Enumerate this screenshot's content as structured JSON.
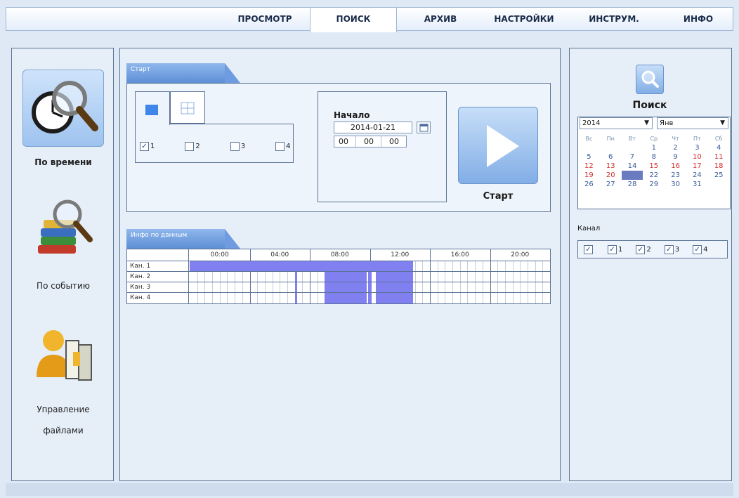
{
  "nav": {
    "tabs": [
      "ПРОСМОТР",
      "ПОИСК",
      "АРХИВ",
      "НАСТРОЙКИ",
      "ИНСТРУМ.",
      "ИНФО"
    ],
    "active_tab": "ПОИСК"
  },
  "sidebar": {
    "items": [
      {
        "label": "По времени",
        "icon": "clock-search-icon",
        "selected": true
      },
      {
        "label": "По событию",
        "icon": "books-search-icon",
        "selected": false
      },
      {
        "label_line1": "Управление",
        "label_line2": "файлами",
        "icon": "user-files-icon",
        "selected": false
      }
    ]
  },
  "start_section": {
    "tab_label": "Старт",
    "layout_buttons": [
      "single-view-icon",
      "quad-view-icon"
    ],
    "channels": [
      {
        "label": "1",
        "checked": true
      },
      {
        "label": "2",
        "checked": false
      },
      {
        "label": "3",
        "checked": false
      },
      {
        "label": "4",
        "checked": false
      }
    ],
    "start_title": "Начало",
    "date": "2014-01-21",
    "time_h": "00",
    "time_m": "00",
    "time_s": "00",
    "play_label": "Старт"
  },
  "data_info": {
    "tab_label": "Инфо по данным",
    "hours": [
      "00:00",
      "04:00",
      "08:00",
      "12:00",
      "16:00",
      "20:00"
    ],
    "rows": [
      {
        "label": "Кан. 1",
        "segments": [
          [
            0,
            14.9
          ]
        ]
      },
      {
        "label": "Кан. 2",
        "segments": [
          [
            7.0,
            7.15
          ],
          [
            9.0,
            11.8
          ],
          [
            11.9,
            12.1
          ],
          [
            12.4,
            14.9
          ]
        ]
      },
      {
        "label": "Кан. 3",
        "segments": [
          [
            7.0,
            7.15
          ],
          [
            9.0,
            11.8
          ],
          [
            11.9,
            12.1
          ],
          [
            12.4,
            14.9
          ]
        ]
      },
      {
        "label": "Кан. 4",
        "segments": [
          [
            7.0,
            7.15
          ],
          [
            9.0,
            11.8
          ],
          [
            11.9,
            12.1
          ],
          [
            12.4,
            14.9
          ]
        ]
      }
    ]
  },
  "calendar": {
    "title": "Поиск",
    "year": "2014",
    "month": "Янв",
    "weekdays": [
      "Вс",
      "Пн",
      "Вт",
      "Ср",
      "Чт",
      "Пт",
      "Сб"
    ],
    "weeks": [
      [
        "",
        "",
        "",
        "1",
        "2",
        "3",
        "4"
      ],
      [
        "5",
        "6",
        "7",
        "8",
        "9",
        "10",
        "11"
      ],
      [
        "12",
        "13",
        "14",
        "15",
        "16",
        "17",
        "18"
      ],
      [
        "19",
        "20",
        "21",
        "22",
        "23",
        "24",
        "25"
      ],
      [
        "26",
        "27",
        "28",
        "29",
        "30",
        "31",
        ""
      ]
    ],
    "red_days": [
      "10",
      "11",
      "12",
      "13",
      "15",
      "16",
      "17",
      "18",
      "19",
      "20"
    ],
    "selected_day": "21"
  },
  "channel_filter": {
    "label": "Канал",
    "all_checked": true,
    "channels": [
      "1",
      "2",
      "3",
      "4"
    ]
  },
  "colors": {
    "record": "#8080f0",
    "accent": "#5d8fd6"
  }
}
